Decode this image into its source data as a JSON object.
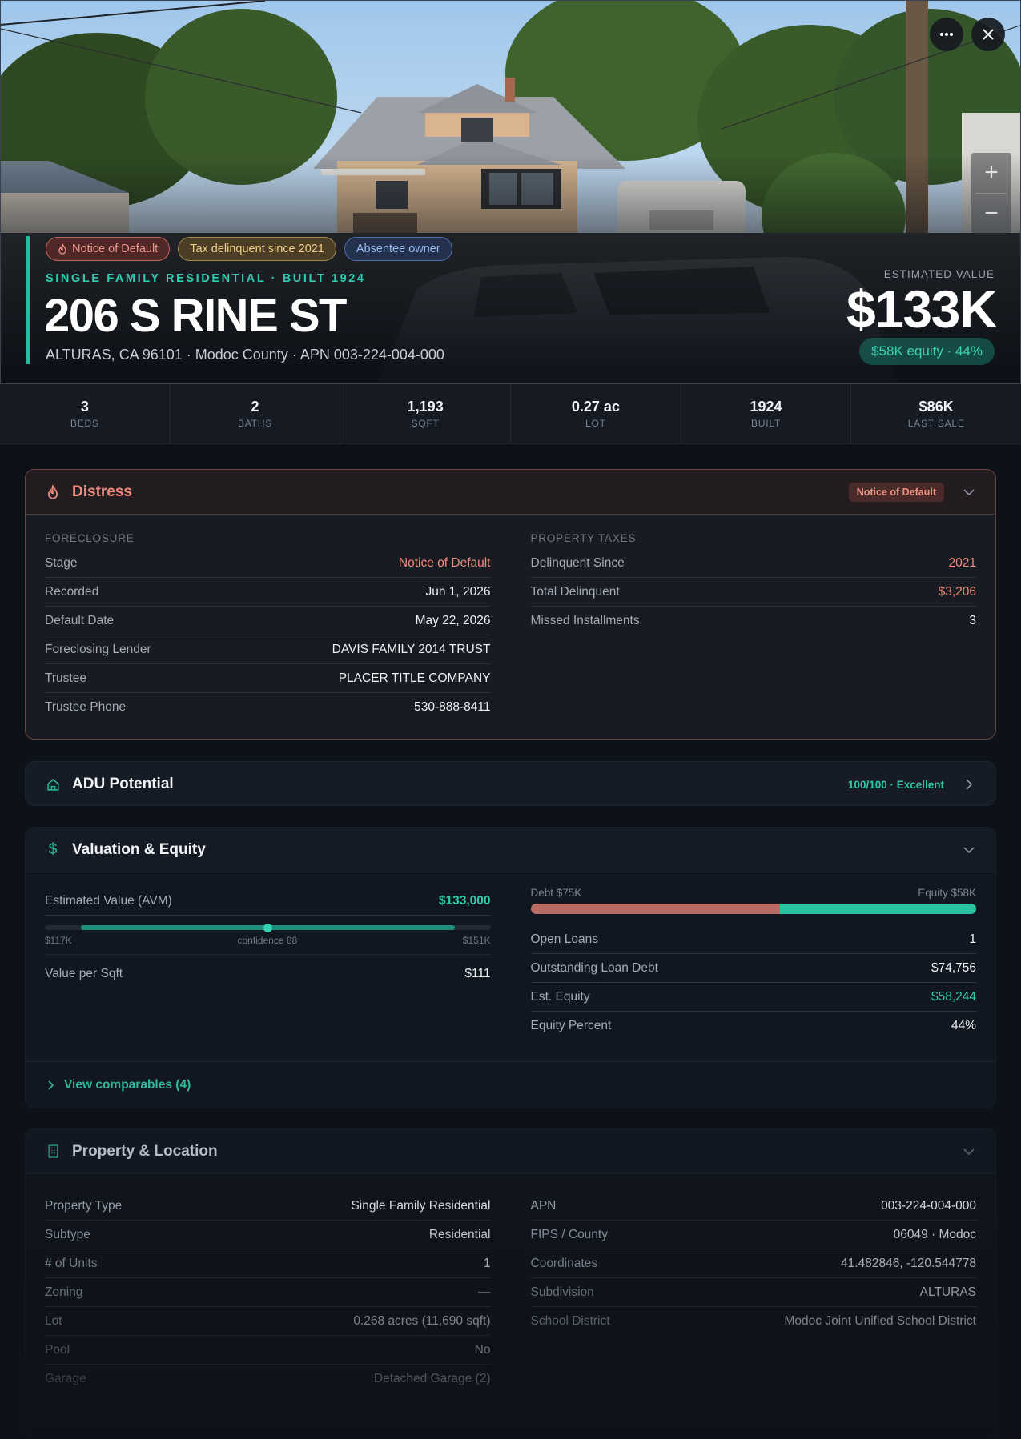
{
  "header": {
    "more_icon": "ellipsis-icon",
    "close_icon": "close-icon",
    "zoom_in": "+",
    "zoom_out": "−",
    "tags": [
      {
        "label": "Notice of Default",
        "icon": "flame-icon"
      },
      {
        "label": "Tax delinquent since 2021"
      },
      {
        "label": "Absentee owner"
      }
    ],
    "subtitle": "SINGLE FAMILY RESIDENTIAL · BUILT 1924",
    "address": "206 S RINE ST",
    "location": "ALTURAS, CA 96101 · Modoc County · APN 003-224-004-000",
    "estimated_value_label": "ESTIMATED VALUE",
    "estimated_value": "$133K",
    "equity_pill": "$58K equity · 44%"
  },
  "stats": [
    {
      "value": "3",
      "label": "BEDS"
    },
    {
      "value": "2",
      "label": "BATHS"
    },
    {
      "value": "1,193",
      "label": "SQFT"
    },
    {
      "value": "0.27 ac",
      "label": "LOT"
    },
    {
      "value": "1924",
      "label": "BUILT"
    },
    {
      "value": "$86K",
      "label": "LAST SALE"
    }
  ],
  "distress": {
    "title": "Distress",
    "badge": "Notice of Default",
    "foreclosure": {
      "label": "FORECLOSURE",
      "rows": [
        {
          "k": "Stage",
          "v": "Notice of Default"
        },
        {
          "k": "Recorded",
          "v": "Jun 1, 2026"
        },
        {
          "k": "Default Date",
          "v": "May 22, 2026"
        },
        {
          "k": "Foreclosing Lender",
          "v": "DAVIS FAMILY 2014 TRUST"
        },
        {
          "k": "Trustee",
          "v": "PLACER TITLE COMPANY"
        },
        {
          "k": "Trustee Phone",
          "v": "530-888-8411"
        }
      ]
    },
    "taxes": {
      "label": "PROPERTY TAXES",
      "rows": [
        {
          "k": "Delinquent Since",
          "v": "2021"
        },
        {
          "k": "Total Delinquent",
          "v": "$3,206"
        },
        {
          "k": "Missed Installments",
          "v": "3"
        }
      ]
    }
  },
  "adu": {
    "title": "ADU Potential",
    "score": "100/100 · Excellent"
  },
  "valuation": {
    "title": "Valuation & Equity",
    "avm_label": "Estimated Value (AVM)",
    "avm_value": "$133,000",
    "range_low": "$117K",
    "range_high": "$151K",
    "confidence_label": "confidence 88",
    "confidence_position": 0.5,
    "value_per_sqft_label": "Value per Sqft",
    "value_per_sqft": "$111",
    "debt_label": "Debt $75K",
    "equity_label": "Equity $58K",
    "debt_fraction": 0.56,
    "loan_rows": [
      {
        "k": "Open Loans",
        "v": "1"
      },
      {
        "k": "Outstanding Loan Debt",
        "v": "$74,756"
      },
      {
        "k": "Est. Equity",
        "v": "$58,244"
      },
      {
        "k": "Equity Percent",
        "v": "44%"
      }
    ],
    "comparables_link": "View comparables (4)"
  },
  "property": {
    "title": "Property & Location",
    "left_rows": [
      {
        "k": "Property Type",
        "v": "Single Family Residential"
      },
      {
        "k": "Subtype",
        "v": "Residential"
      },
      {
        "k": "# of Units",
        "v": "1"
      },
      {
        "k": "Zoning",
        "v": "—"
      },
      {
        "k": "Lot",
        "v": "0.268 acres (11,690 sqft)"
      },
      {
        "k": "Pool",
        "v": "No"
      },
      {
        "k": "Garage",
        "v": "Detached Garage (2)"
      }
    ],
    "right_rows": [
      {
        "k": "APN",
        "v": "003-224-004-000"
      },
      {
        "k": "FIPS / County",
        "v": "06049 · Modoc"
      },
      {
        "k": "Coordinates",
        "v": "41.482846, -120.544778"
      },
      {
        "k": "Subdivision",
        "v": "ALTURAS"
      },
      {
        "k": "School District",
        "v": "Modoc Joint Unified School District"
      }
    ]
  },
  "colors": {
    "accent": "#24bfa3",
    "distress": "#ee8a7d",
    "debt": "#b86b63",
    "equity": "#2cc3a2"
  }
}
